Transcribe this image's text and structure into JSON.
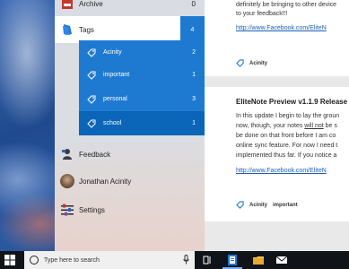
{
  "nav": {
    "archive": {
      "label": "Archive",
      "count": "0"
    },
    "tags": {
      "label": "Tags",
      "count": "4"
    },
    "tag_items": [
      {
        "label": "Acinity",
        "count": "2"
      },
      {
        "label": "important",
        "count": "1"
      },
      {
        "label": "personal",
        "count": "3"
      },
      {
        "label": "school",
        "count": "1"
      }
    ],
    "feedback": {
      "label": "Feedback"
    },
    "user": {
      "label": "Jonathan Acinity"
    },
    "settings": {
      "label": "Settings"
    }
  },
  "notes": {
    "card1": {
      "lines": [
        "definitely be bringing to other device",
        "to your feedback!!!"
      ],
      "link": "http://www.Facebook.com/EliteN",
      "tags": [
        "Acinity"
      ]
    },
    "card2": {
      "title": "EliteNote Preview v1.1.9 Release I",
      "line1": "In this update I begin to lay the groun",
      "line2_before": "now, though, your notes ",
      "line2_underlined": "will not",
      "line2_after": " be s",
      "line3": "be done on that front before I am co",
      "line4": "online sync feature. For now I need t",
      "line5": "implemented thus far. If you notice a",
      "link": "http://www.Facebook.com/EliteN",
      "tags": [
        "Acinity",
        "important"
      ]
    }
  },
  "taskbar": {
    "search_placeholder": "Type here to search"
  },
  "colors": {
    "accent": "#1e7ad1",
    "accent_selected": "#0b65b8",
    "link": "#1a5fb4",
    "taskbar": "#101418"
  }
}
